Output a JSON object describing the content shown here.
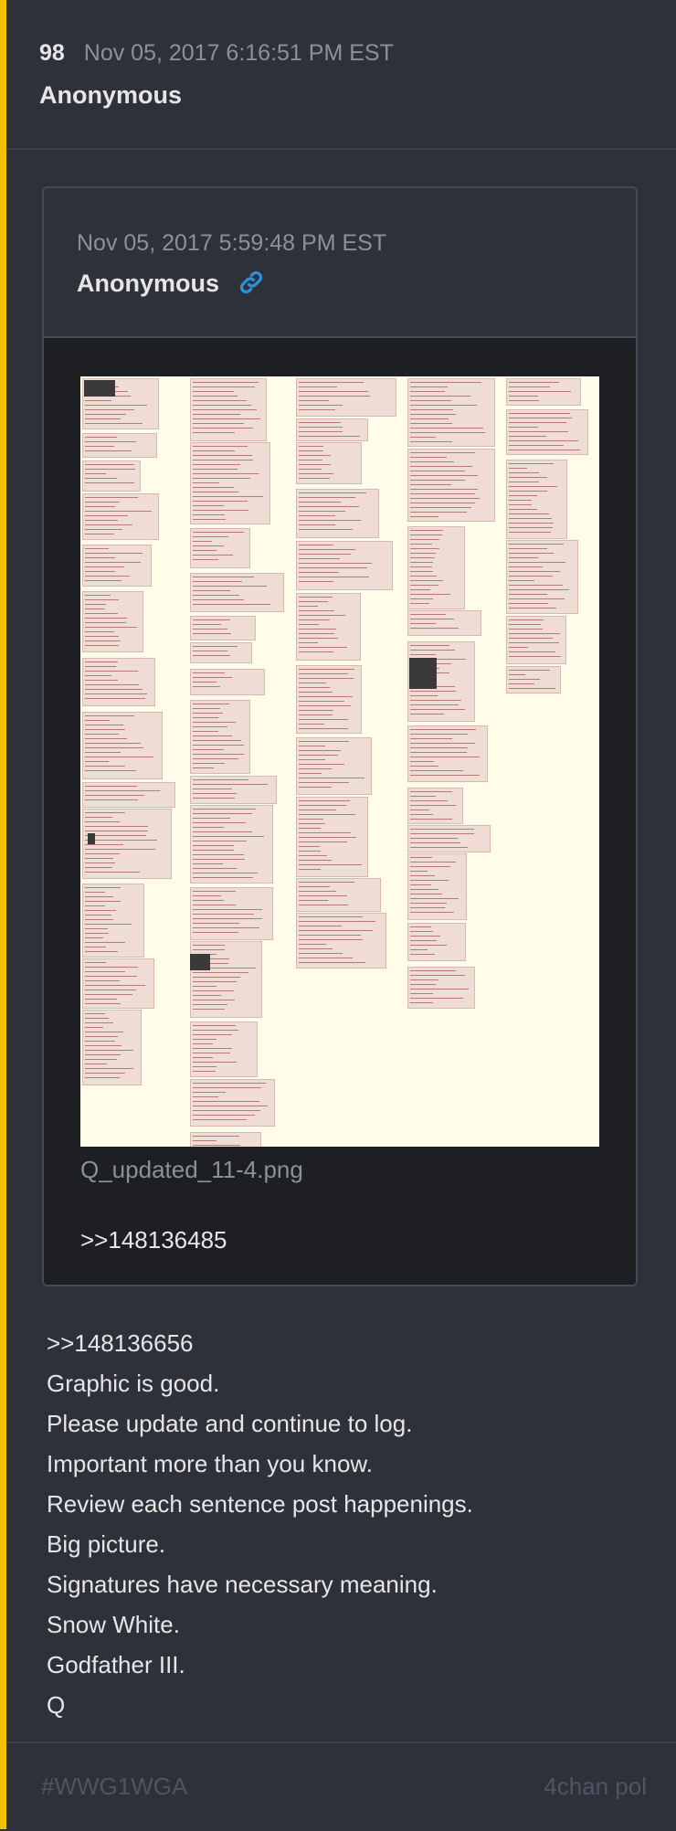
{
  "post": {
    "number": "98",
    "date": "Nov 05, 2017 6:16:51 PM EST",
    "author": "Anonymous",
    "accent_color": "#f2c200"
  },
  "quoted_post": {
    "date": "Nov 05, 2017 5:59:48 PM EST",
    "author": "Anonymous",
    "link_icon": "link-icon",
    "link_color": "#2f8fd8",
    "image_filename": "Q_updated_11-4.png",
    "reference": ">>148136485"
  },
  "body_lines": [
    ">>148136656",
    "Graphic is good.",
    "Please update and continue to log.",
    "Important more than you know.",
    "Review each sentence post happenings.",
    "Big picture.",
    "Signatures have necessary meaning.",
    "Snow White.",
    "Godfather III.",
    "Q"
  ],
  "footer": {
    "tag": "#WWG1WGA",
    "source": "4chan pol"
  }
}
